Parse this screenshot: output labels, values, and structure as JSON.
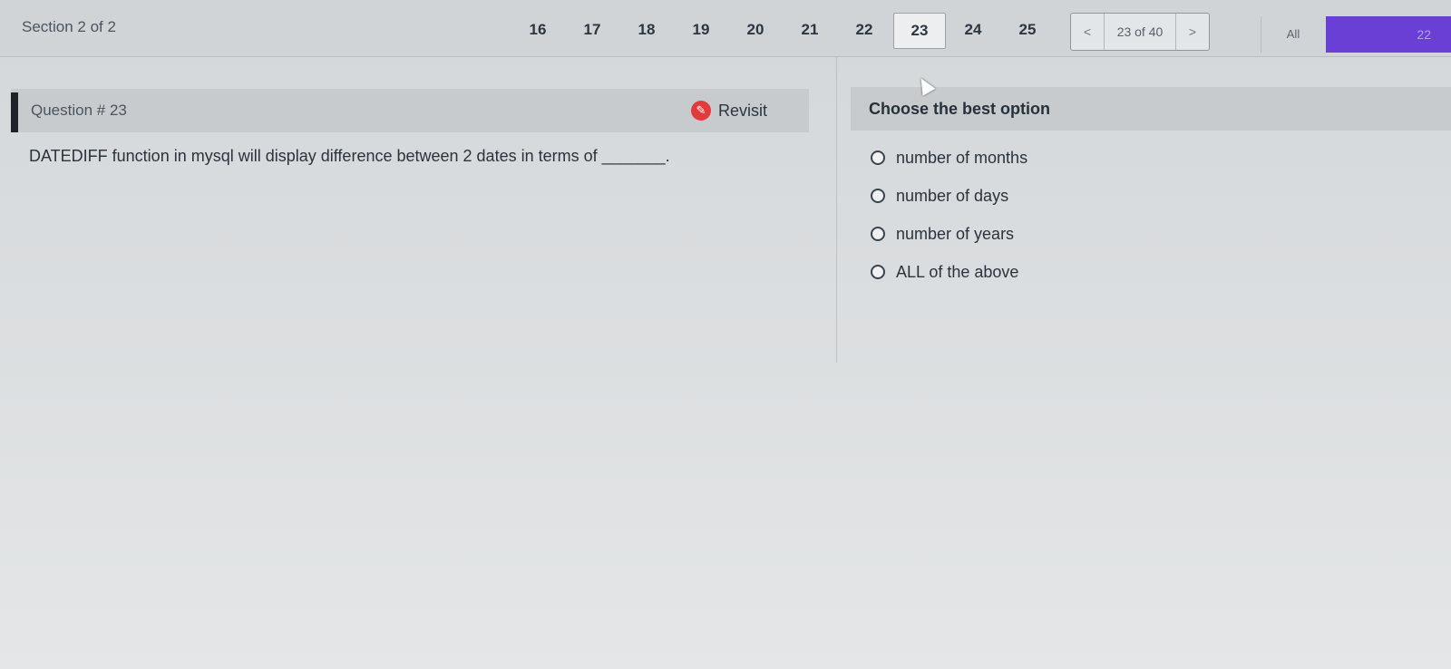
{
  "nav": {
    "section_label": "Section 2 of 2",
    "question_numbers": [
      "16",
      "17",
      "18",
      "19",
      "20",
      "21",
      "22",
      "23",
      "24",
      "25"
    ],
    "current_question": "23",
    "prev_label": "<",
    "next_label": ">",
    "page_count": "23 of 40",
    "filter_label": "All",
    "timer_value": "22"
  },
  "question": {
    "title": "Question # 23",
    "revisit_label": "Revisit",
    "text": "DATEDIFF function in mysql will display difference between 2 dates in terms of _______."
  },
  "options": {
    "header": "Choose the best option",
    "items": [
      "number of months",
      "number of days",
      "number of years",
      "ALL of the above"
    ]
  },
  "colors": {
    "accent": "#6a3fd6",
    "revisit": "#e23b3b"
  }
}
